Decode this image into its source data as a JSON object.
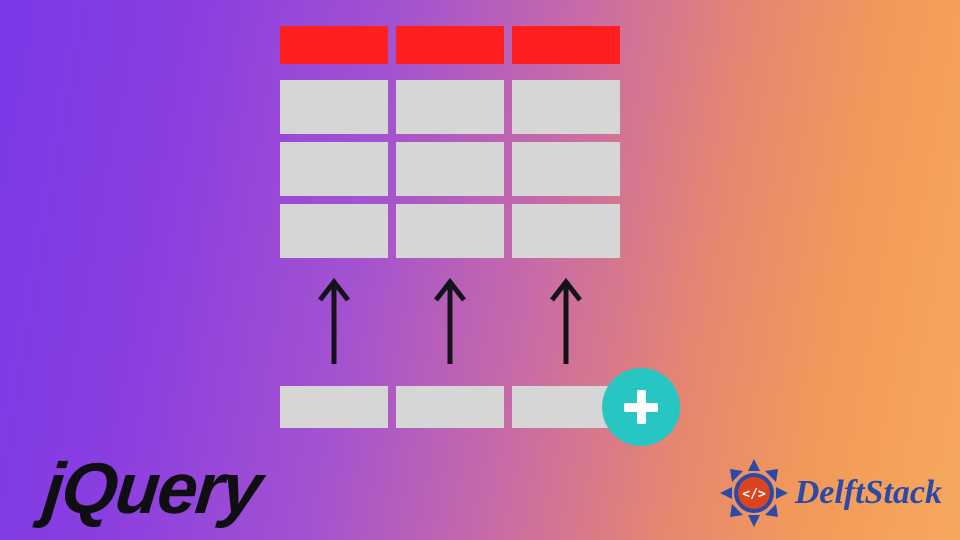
{
  "diagram": {
    "concept": "Add table row with jQuery",
    "columns": 3,
    "header_cells": [
      "",
      "",
      ""
    ],
    "body_rows": [
      [
        "",
        "",
        ""
      ],
      [
        "",
        "",
        ""
      ],
      [
        "",
        "",
        ""
      ]
    ],
    "new_row": [
      "",
      "",
      ""
    ],
    "arrow_count": 3,
    "add_icon": "plus"
  },
  "colors": {
    "header": "#ff1f1f",
    "cell": "#d6d6d6",
    "add_badge": "#27c6c2",
    "add_plus": "#ffffff",
    "arrow": "#14131a",
    "jquery_logo": "#0f0f13",
    "delft_text": "#2b4aa8",
    "delft_emblem_outer": "#2b4aa8",
    "delft_emblem_inner": "#d9451f"
  },
  "logos": {
    "jquery": "jQuery",
    "delftstack": "DelftStack",
    "delftstack_code": "</>"
  }
}
